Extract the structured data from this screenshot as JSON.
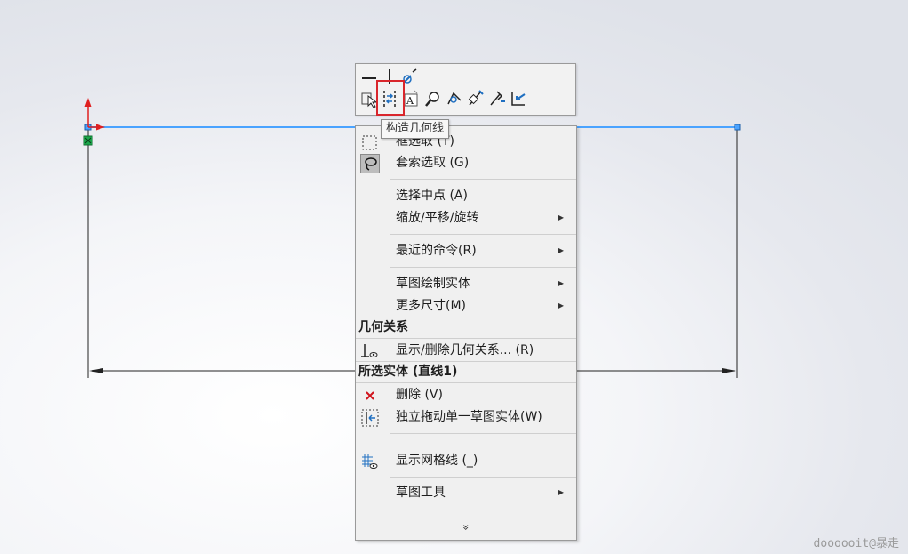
{
  "toolbar": {
    "icons": [
      "line-icon",
      "vertical-line-icon",
      "sketch-tool-icon",
      "select-icon",
      "construction-geometry-icon",
      "text-icon",
      "zoom-icon",
      "smart-dimension-icon",
      "relations-icon",
      "trim-icon",
      "exit-sketch-icon"
    ]
  },
  "tooltip": {
    "text": "构造几何线"
  },
  "menu": {
    "items": [
      {
        "label": "框选取 (T)",
        "icon": "box-select-icon"
      },
      {
        "label": "套索选取 (G)",
        "icon": "lasso-select-icon"
      },
      {
        "label": "选择中点 (A)",
        "icon": ""
      },
      {
        "label": "缩放/平移/旋转",
        "submenu": true
      },
      {
        "label": "最近的命令(R)",
        "submenu": true
      },
      {
        "label": "草图绘制实体",
        "submenu": true
      },
      {
        "label": "更多尺寸(M)",
        "submenu": true
      }
    ],
    "section_relations": "几何关系",
    "show_relations": "显示/删除几何关系... (R)",
    "section_selected": "所选实体 (直线1)",
    "delete": "删除 (V)",
    "drag_entity": "独立拖动单一草图实体(W)",
    "show_grid": "显示网格线 (_)",
    "sketch_tools": "草图工具",
    "more": "»"
  },
  "watermark": "doooooit@暴走",
  "colors": {
    "selected_line": "#4aa3ff",
    "highlight_box": "#d9262c",
    "origin_red": "#e02020",
    "origin_green": "#1aa64a"
  }
}
